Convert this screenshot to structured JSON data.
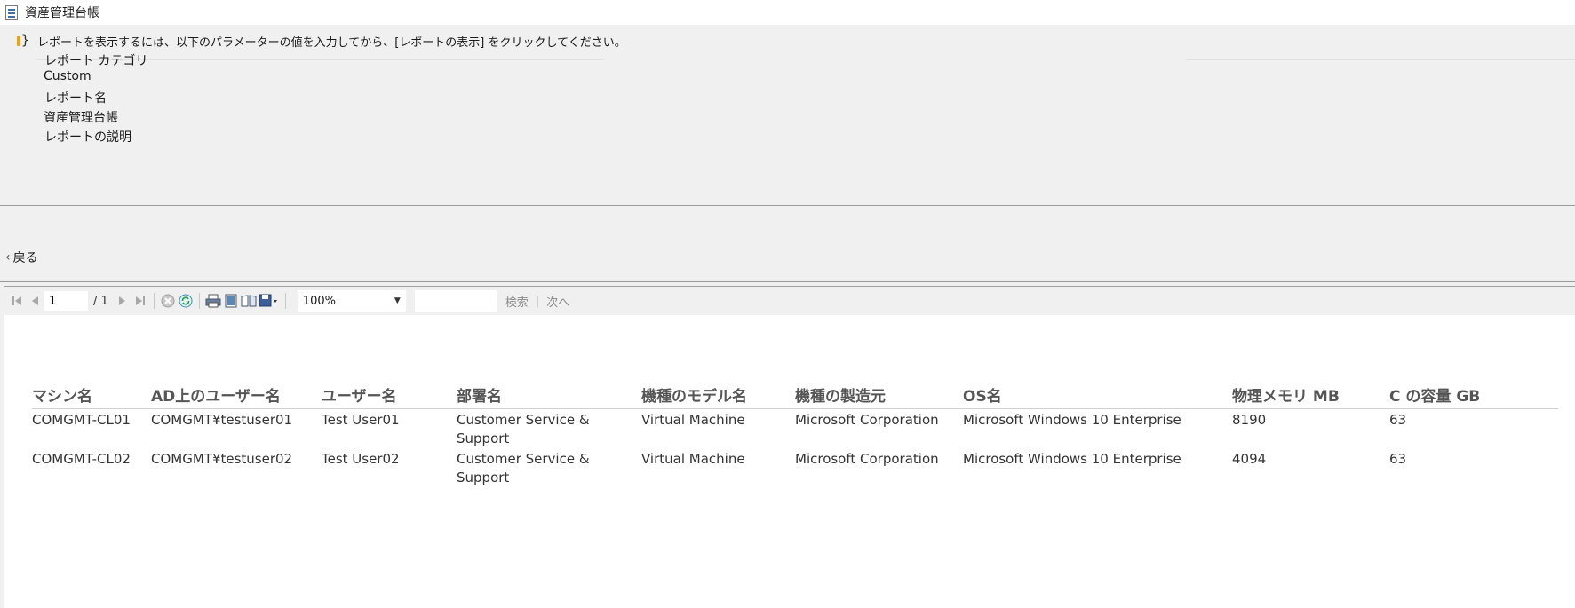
{
  "window": {
    "title": "資産管理台帳",
    "icon": "report-icon"
  },
  "params": {
    "info_message": "レポートを表示するには、以下のパラメーターの値を入力してから、[レポートの表示] をクリックしてください。",
    "category_label": "レポート カテゴリ",
    "category_value": "Custom",
    "name_label": "レポート名",
    "name_value": "資産管理台帳",
    "description_label": "レポートの説明"
  },
  "nav": {
    "back_label": "戻る"
  },
  "toolbar": {
    "current_page": "1",
    "total_pages": "/ 1",
    "zoom": "100%",
    "search_placeholder": "",
    "find_label": "検索",
    "find_separator": "|",
    "next_label": "次へ",
    "icons": [
      "first-page-icon",
      "prev-page-icon",
      "next-page-icon",
      "last-page-icon",
      "stop-icon",
      "refresh-icon",
      "print-icon",
      "print-layout-icon",
      "page-setup-icon",
      "export-icon"
    ]
  },
  "table": {
    "headers": [
      "マシン名",
      "AD上のユーザー名",
      "ユーザー名",
      "部署名",
      "機種のモデル名",
      "機種の製造元",
      "OS名",
      "物理メモリ MB",
      "C の容量 GB"
    ],
    "rows": [
      [
        "COMGMT-CL01",
        "COMGMT¥testuser01",
        "Test User01",
        "Customer Service & Support",
        "Virtual Machine",
        "Microsoft Corporation",
        "Microsoft Windows 10 Enterprise",
        "8190",
        "63"
      ],
      [
        "COMGMT-CL02",
        "COMGMT¥testuser02",
        "Test User02",
        "Customer Service & Support",
        "Virtual Machine",
        "Microsoft Corporation",
        "Microsoft Windows 10 Enterprise",
        "4094",
        "63"
      ]
    ]
  },
  "colors": {
    "accent": "#2f5c9a",
    "warning": "#f0a30a",
    "panel_bg": "#f0f0f0"
  }
}
